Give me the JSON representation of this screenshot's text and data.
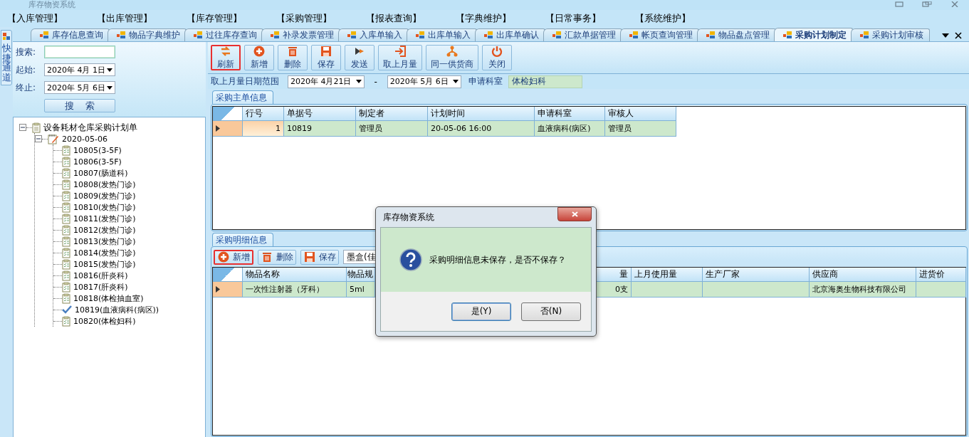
{
  "window": {
    "title": "库存物资系统"
  },
  "menu": [
    "【入库管理】",
    "【出库管理】",
    "【库存管理】",
    "【采购管理】",
    "【报表查询】",
    "【字典维护】",
    "【日常事务】",
    "【系统维护】"
  ],
  "side_strip": {
    "label": "快捷通道"
  },
  "tabs": [
    {
      "label": "库存信息查询",
      "selected": false
    },
    {
      "label": "物品字典维护",
      "selected": false
    },
    {
      "label": "过往库存查询",
      "selected": false
    },
    {
      "label": "补录发票管理",
      "selected": false
    },
    {
      "label": "入库单输入",
      "selected": false
    },
    {
      "label": "出库单输入",
      "selected": false
    },
    {
      "label": "出库单确认",
      "selected": false
    },
    {
      "label": "汇款单据管理",
      "selected": false
    },
    {
      "label": "帐页查询管理",
      "selected": false
    },
    {
      "label": "物品盘点管理",
      "selected": false
    },
    {
      "label": "采购计划制定",
      "selected": true
    },
    {
      "label": "采购计划审核",
      "selected": false
    }
  ],
  "search_panel": {
    "search_label": "搜索:",
    "start_label": "起始:",
    "start_date": "2020年 4月 1日",
    "end_label": "终止:",
    "end_date": "2020年 5月 6日",
    "search_button": "搜    索"
  },
  "tree": {
    "label": "设备耗材仓库采购计划单",
    "expanded": true,
    "children": [
      {
        "label": "2020-05-06",
        "expanded": true,
        "children": [
          {
            "label": "10805(3-5F)",
            "checked": false
          },
          {
            "label": "10806(3-5F)",
            "checked": false
          },
          {
            "label": "10807(肠道科)",
            "checked": false
          },
          {
            "label": "10808(发热门诊)",
            "checked": false
          },
          {
            "label": "10809(发热门诊)",
            "checked": false
          },
          {
            "label": "10810(发热门诊)",
            "checked": false
          },
          {
            "label": "10811(发热门诊)",
            "checked": false
          },
          {
            "label": "10812(发热门诊)",
            "checked": false
          },
          {
            "label": "10813(发热门诊)",
            "checked": false
          },
          {
            "label": "10814(发热门诊)",
            "checked": false
          },
          {
            "label": "10815(发热门诊)",
            "checked": false
          },
          {
            "label": "10816(肝炎科)",
            "checked": false
          },
          {
            "label": "10817(肝炎科)",
            "checked": false
          },
          {
            "label": "10818(体检抽血室)",
            "checked": false
          },
          {
            "label": "10819(血液病科(病区))",
            "checked": true
          },
          {
            "label": "10820(体检妇科)",
            "checked": false
          }
        ]
      }
    ]
  },
  "toolbar": {
    "buttons": [
      {
        "label": "刷新",
        "kind": "refresh",
        "highlighted": true
      },
      {
        "label": "新增",
        "kind": "add",
        "highlighted": false
      },
      {
        "label": "删除",
        "kind": "delete",
        "highlighted": false
      },
      {
        "label": "保存",
        "kind": "save",
        "highlighted": false
      },
      {
        "label": "发送",
        "kind": "send",
        "highlighted": false
      },
      {
        "label": "取上月量",
        "kind": "import",
        "highlighted": false
      },
      {
        "label": "同一供货商",
        "kind": "supplier",
        "highlighted": false
      },
      {
        "label": "关闭",
        "kind": "power",
        "highlighted": false
      }
    ]
  },
  "filter": {
    "range_label": "取上月量日期范围",
    "from": "2020年 4月21日",
    "separator": "-",
    "to": "2020年 5月 6日",
    "dept_label": "申请科室",
    "dept_value": "体检妇科"
  },
  "master": {
    "title": "采购主单信息",
    "columns": [
      "行号",
      "单据号",
      "制定者",
      "计划时间",
      "申请科室",
      "审核人"
    ],
    "rows": [
      {
        "cells": [
          "1",
          "10819",
          "管理员",
          "20-05-06 16:00",
          "血液病科(病区)",
          "管理员"
        ],
        "selected": true
      }
    ]
  },
  "detail": {
    "title": "采购明细信息",
    "buttons": [
      {
        "label": "新增",
        "kind": "add",
        "highlighted": true
      },
      {
        "label": "删除",
        "kind": "delete",
        "highlighted": false
      },
      {
        "label": "保存",
        "kind": "save",
        "highlighted": false
      }
    ],
    "item_field": "墨盒(佳",
    "columns": [
      "物品名称",
      "物品规",
      "量",
      "上月使用量",
      "生产厂家",
      "供应商",
      "进货价"
    ],
    "rows": [
      {
        "cells": [
          "一次性注射器（牙科）",
          "5ml",
          "0支",
          null,
          null,
          "北京海奥生物科技有限公司",
          null
        ],
        "selected": true
      }
    ]
  },
  "dialog": {
    "title": "库存物资系统",
    "message": "采购明细信息未保存，是否不保存？",
    "buttons": [
      {
        "label": "是(Y)",
        "default": true
      },
      {
        "label": "否(N)",
        "default": false
      }
    ]
  }
}
